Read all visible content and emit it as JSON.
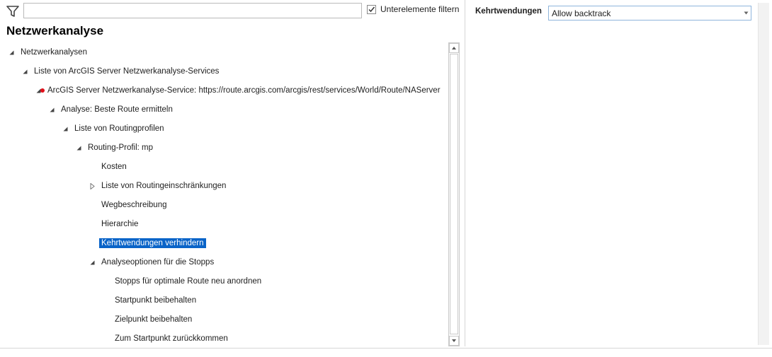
{
  "toolbar": {
    "search_value": "",
    "search_placeholder": "",
    "filter_icon": "filter-funnel-icon",
    "subelements_filter_label": "Unterelemente filtern",
    "subelements_filter_checked": true
  },
  "page": {
    "title": "Netzwerkanalyse"
  },
  "tree": {
    "nodes": [
      {
        "label": "Netzwerkanalysen",
        "expander": "expanded"
      },
      {
        "label": "Liste von ArcGIS Server Netzwerkanalyse-Services",
        "expander": "expanded"
      },
      {
        "label": "ArcGIS Server Netzwerkanalyse-Service: https://route.arcgis.com/arcgis/rest/services/World/Route/NAServer",
        "expander": "expanded",
        "status": "error-dot"
      },
      {
        "label": "Analyse: Beste Route ermitteln",
        "expander": "expanded"
      },
      {
        "label": "Liste von Routingprofilen",
        "expander": "expanded"
      },
      {
        "label": "Routing-Profil: mp",
        "expander": "expanded"
      },
      {
        "label": "Kosten",
        "expander": "none"
      },
      {
        "label": "Liste von Routingeinschränkungen",
        "expander": "collapsed"
      },
      {
        "label": "Wegbeschreibung",
        "expander": "none"
      },
      {
        "label": "Hierarchie",
        "expander": "none"
      },
      {
        "label": "Kehrtwendungen verhindern",
        "expander": "none",
        "selected": true
      },
      {
        "label": "Analyseoptionen für die Stopps",
        "expander": "expanded"
      },
      {
        "label": "Stopps für optimale Route neu anordnen",
        "expander": "none"
      },
      {
        "label": "Startpunkt beibehalten",
        "expander": "none"
      },
      {
        "label": "Zielpunkt beibehalten",
        "expander": "none"
      },
      {
        "label": "Zum Startpunkt zurückkommen",
        "expander": "none"
      }
    ]
  },
  "properties": {
    "label": "Kehrtwendungen",
    "value": "Allow backtrack"
  },
  "colors": {
    "selection": "#0a64c8",
    "status_error": "#e0101a",
    "select_border": "#8fb5dc"
  }
}
